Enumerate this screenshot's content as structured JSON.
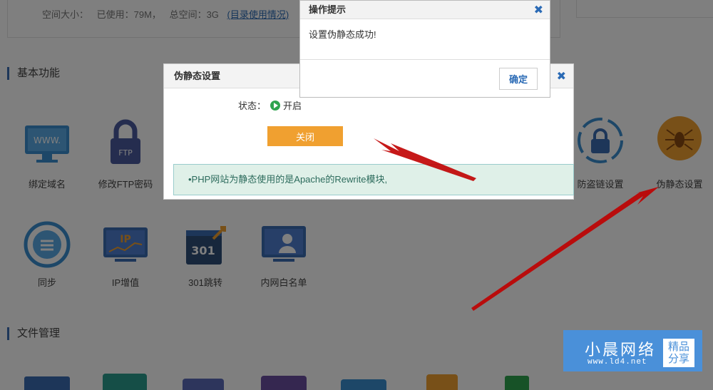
{
  "space": {
    "label": "空间大小：",
    "used": "已使用：79M，",
    "total": "总空间：3G",
    "link": "(目录使用情况)"
  },
  "sections": {
    "basic": "基本功能",
    "files": "文件管理"
  },
  "functions_row1": [
    {
      "label": "绑定域名",
      "icon": "www-monitor-icon"
    },
    {
      "label": "修改FTP密码",
      "icon": "ftp-lock-icon"
    },
    {
      "label": "防盗链设置",
      "icon": "anti-leech-lock-icon"
    },
    {
      "label": "伪静态设置",
      "icon": "spider-icon"
    }
  ],
  "functions_row2": [
    {
      "label": "同步",
      "icon": "sync-icon"
    },
    {
      "label": "IP增值",
      "icon": "ip-chart-icon"
    },
    {
      "label": "301跳转",
      "icon": "redirect-301-icon"
    },
    {
      "label": "内网白名单",
      "icon": "whitelist-user-icon"
    }
  ],
  "panel": {
    "title": "伪静态设置",
    "close_symbol": "✖",
    "status_label": "状态：",
    "status_value": "开启",
    "close_button": "关闭",
    "tip": "•PHP网站为静态使用的是Apache的Rewrite模块,"
  },
  "dialog": {
    "title": "操作提示",
    "close_symbol": "✖",
    "message": "设置伪静态成功!",
    "confirm": "确定"
  },
  "watermark": {
    "title": "小晨网络",
    "url": "www.ld4.net",
    "tag_line1": "精品",
    "tag_line2": "分享"
  },
  "colors": {
    "accent": "#2a6ab5",
    "close_button": "#f0a030",
    "status_on": "#2ea44f",
    "arrow": "#c00000",
    "watermark_bg": "#4a90d9"
  }
}
